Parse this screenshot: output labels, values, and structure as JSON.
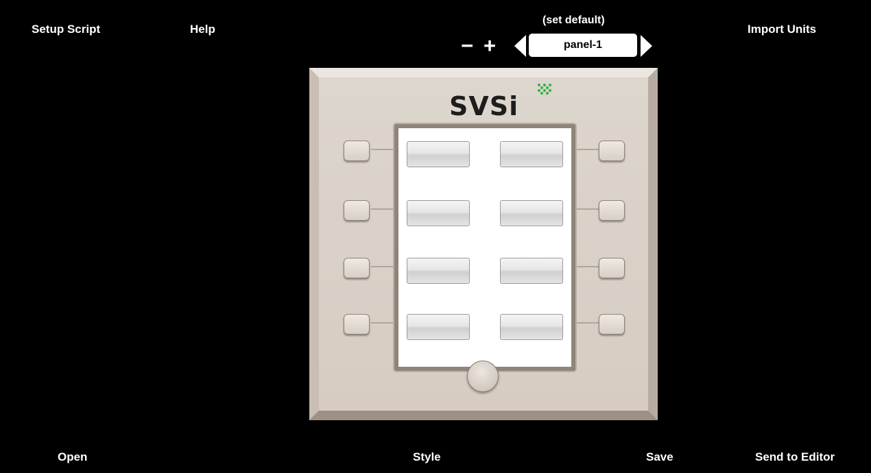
{
  "toolbar": {
    "setup_script": "Setup Script",
    "help": "Help",
    "import_units": "Import Units",
    "set_default": "(set default)",
    "minus": "−",
    "plus": "+",
    "panel_name": "panel-1"
  },
  "footer": {
    "open": "Open",
    "style": "Style",
    "save": "Save",
    "send_to_editor": "Send to Editor"
  },
  "keypad": {
    "logo_text": "SVSi",
    "logo_accent_color": "#2db34a",
    "plate_color": "#d9d1c8",
    "screen_color": "#ffffff",
    "screen_buttons": [
      "",
      "",
      "",
      "",
      "",
      "",
      "",
      ""
    ]
  }
}
